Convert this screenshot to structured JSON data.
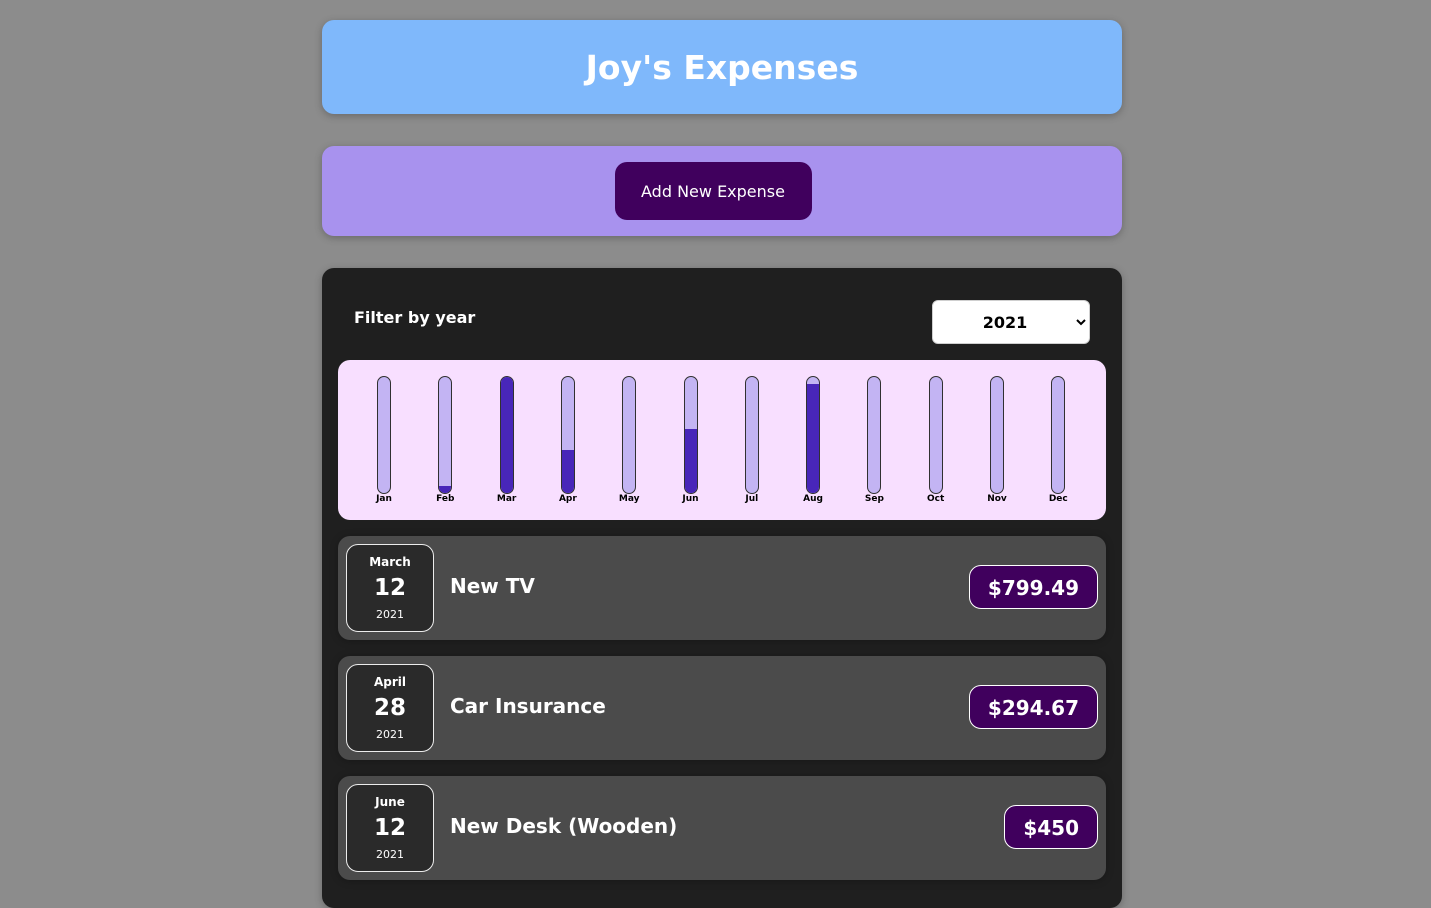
{
  "header": {
    "title": "Joy's Expenses"
  },
  "new_expense": {
    "button_label": "Add New Expense"
  },
  "filter": {
    "label": "Filter by year",
    "selected_year": "2021"
  },
  "chart_data": {
    "type": "bar",
    "categories": [
      "Jan",
      "Feb",
      "Mar",
      "Apr",
      "May",
      "Jun",
      "Jul",
      "Aug",
      "Sep",
      "Oct",
      "Nov",
      "Dec"
    ],
    "fill_fractions": [
      0,
      0.06,
      1.0,
      0.37,
      0,
      0.55,
      0,
      0.94,
      0,
      0,
      0,
      0
    ],
    "ylim": [
      0,
      1
    ]
  },
  "expenses": [
    {
      "month": "March",
      "day": "12",
      "year": "2021",
      "title": "New TV",
      "amount": "$799.49"
    },
    {
      "month": "April",
      "day": "28",
      "year": "2021",
      "title": "Car Insurance",
      "amount": "$294.67"
    },
    {
      "month": "June",
      "day": "12",
      "year": "2021",
      "title": "New Desk (Wooden)",
      "amount": "$450"
    }
  ],
  "colors": {
    "header_bg": "#7fb8fb",
    "new_expense_bg": "#a892ee",
    "button_bg": "#40005d",
    "chart_bg": "#f8dfff",
    "bar_empty": "#c3b4f3",
    "bar_fill": "#4826b9"
  }
}
